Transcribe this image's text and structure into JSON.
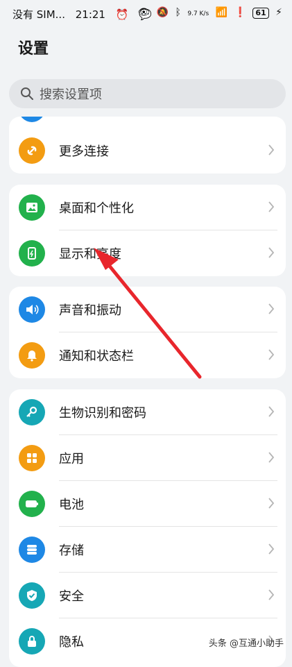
{
  "status": {
    "carrier": "没有 SIM...",
    "time": "21:21",
    "right_text": "9.7 K/s",
    "battery": "61"
  },
  "page_title": "设置",
  "search": {
    "placeholder": "搜索设置项"
  },
  "groups": [
    {
      "items": [
        {
          "label": "更多连接",
          "icon": "link-icon",
          "color": "#f39c12"
        }
      ]
    },
    {
      "items": [
        {
          "label": "桌面和个性化",
          "icon": "image-icon",
          "color": "#22b14c"
        },
        {
          "label": "显示和亮度",
          "icon": "phone-brightness-icon",
          "color": "#22b14c"
        }
      ]
    },
    {
      "items": [
        {
          "label": "声音和振动",
          "icon": "speaker-icon",
          "color": "#1e88e5"
        },
        {
          "label": "通知和状态栏",
          "icon": "bell-icon",
          "color": "#f39c12"
        }
      ]
    },
    {
      "items": [
        {
          "label": "生物识别和密码",
          "icon": "key-icon",
          "color": "#16a7b5"
        },
        {
          "label": "应用",
          "icon": "apps-grid-icon",
          "color": "#f39c12"
        },
        {
          "label": "电池",
          "icon": "battery-icon",
          "color": "#22b14c"
        },
        {
          "label": "存储",
          "icon": "storage-icon",
          "color": "#1e88e5"
        },
        {
          "label": "安全",
          "icon": "shield-icon",
          "color": "#16a7b5"
        },
        {
          "label": "隐私",
          "icon": "lock-icon",
          "color": "#16a7b5"
        }
      ]
    }
  ],
  "watermark": "头条 @互通小助手"
}
